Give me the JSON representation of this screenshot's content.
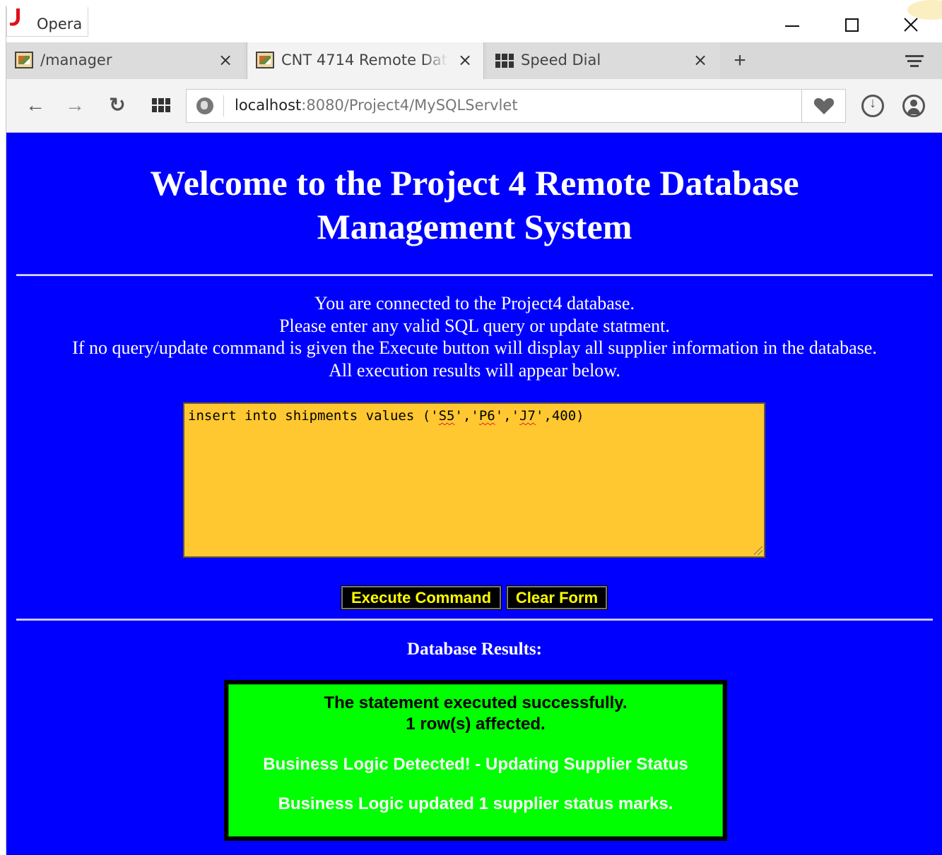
{
  "window": {
    "app_name": "Opera",
    "controls": {
      "minimize": "minimize",
      "maximize": "maximize",
      "close": "close"
    }
  },
  "tabs": [
    {
      "label": "/manager",
      "icon": "tomcat-favicon-icon",
      "active": false
    },
    {
      "label": "CNT 4714 Remote Data",
      "icon": "tomcat-favicon-icon",
      "active": true
    },
    {
      "label": "Speed Dial",
      "icon": "speed-dial-grid-icon",
      "active": false
    }
  ],
  "toolbar": {
    "url_host": "localhost",
    "url_path": ":8080/Project4/MySQLServlet"
  },
  "page": {
    "title_line1": "Welcome to the Project 4 Remote Database",
    "title_line2": "Management System",
    "intro": [
      "You are connected to the Project4 database.",
      "Please enter any valid SQL query or update statment.",
      "If no query/update command is given the Execute button will display all supplier information in the database.",
      "All execution results will appear below."
    ],
    "query": {
      "prefix": "insert into shipments values ('",
      "v1": "S5",
      "sep1": "','",
      "v2": "P6",
      "sep2": "','",
      "v3": "J7",
      "suffix": "',400)"
    },
    "buttons": {
      "execute": "Execute Command",
      "clear": "Clear Form"
    },
    "results_heading": "Database Results:",
    "results": {
      "line1": "The statement executed successfully.",
      "line2": "1 row(s) affected.",
      "line3": "Business Logic Detected! - Updating Supplier Status",
      "line4": "Business Logic updated 1 supplier status marks."
    },
    "colors": {
      "background": "#0000ff",
      "textarea": "#ffc830",
      "button_text": "#ffff00",
      "result_box": "#00ff00"
    }
  }
}
